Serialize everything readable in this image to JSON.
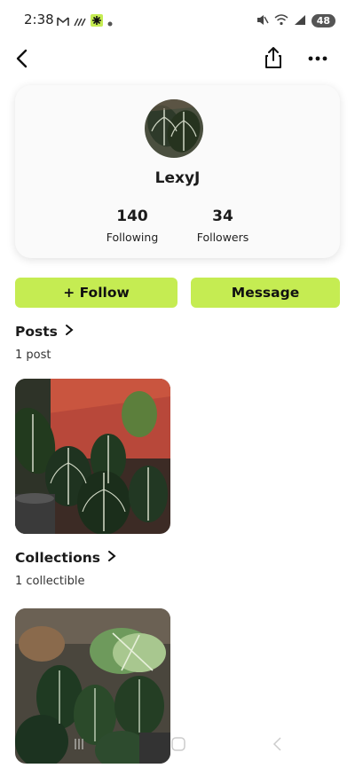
{
  "status": {
    "time": "2:38",
    "battery": "48",
    "left_icons": [
      "gmail-icon",
      "signal-lines-icon",
      "app-icon",
      "dot-icon"
    ],
    "right_icons": [
      "mute-icon",
      "wifi-icon",
      "cell-signal-icon"
    ]
  },
  "header": {
    "back_icon": "back-arrow-icon",
    "share_icon": "share-icon",
    "more_icon": "more-dots-icon"
  },
  "profile": {
    "username": "LexyJ",
    "following_count": "140",
    "following_label": "Following",
    "followers_count": "34",
    "followers_label": "Followers"
  },
  "actions": {
    "follow_label": "+ Follow",
    "message_label": "Message",
    "accent_color": "#c5ec52"
  },
  "posts": {
    "title": "Posts",
    "count_label": "1 post"
  },
  "collections": {
    "title": "Collections",
    "count_label": "1 collectible"
  }
}
